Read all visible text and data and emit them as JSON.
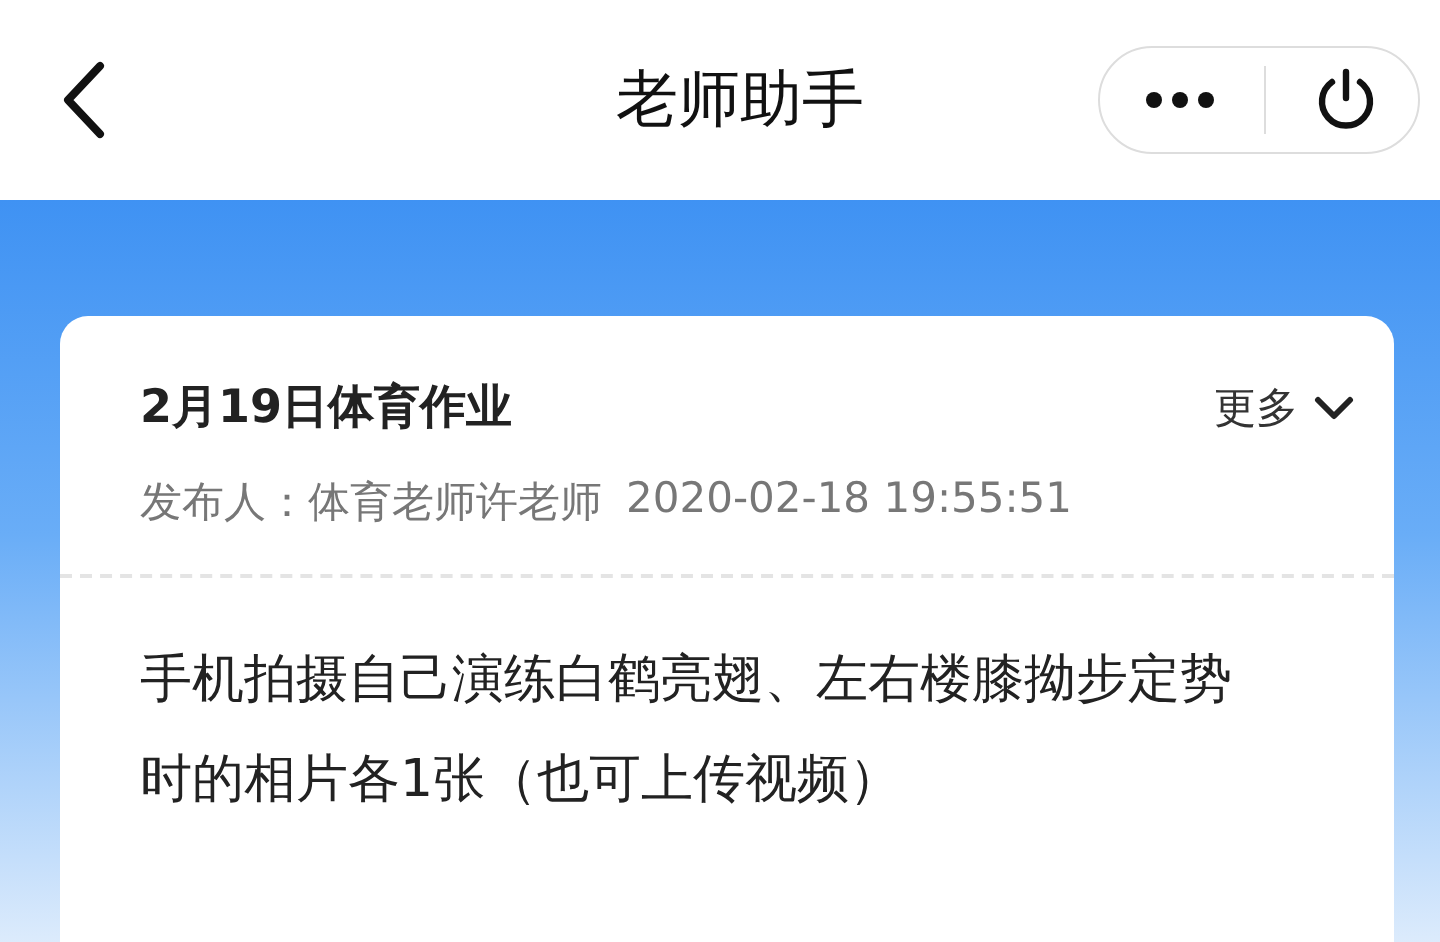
{
  "nav": {
    "title": "老师助手"
  },
  "card": {
    "title": "2月19日体育作业",
    "more": "更多",
    "publisher": "发布人：体育老师许老师",
    "time": "2020-02-18 19:55:51",
    "body": "手机拍摄自己演练白鹤亮翅、左右楼膝拗步定势时的相片各1张（也可上传视频）"
  }
}
